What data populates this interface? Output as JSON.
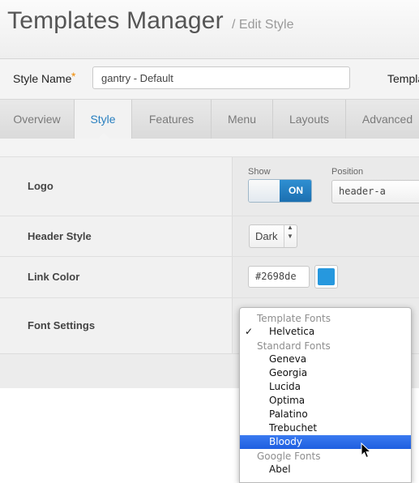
{
  "header": {
    "title": "Templates Manager",
    "subtitle": "/ Edit Style"
  },
  "namebar": {
    "label": "Style Name",
    "required_mark": "*",
    "value": "gantry - Default",
    "template_label": "Template"
  },
  "tabs": [
    {
      "label": "Overview"
    },
    {
      "label": "Style",
      "active": true
    },
    {
      "label": "Features"
    },
    {
      "label": "Menu"
    },
    {
      "label": "Layouts"
    },
    {
      "label": "Advanced"
    }
  ],
  "logo": {
    "label": "Logo",
    "show_label": "Show",
    "toggle_on_label": "ON",
    "position_label": "Position",
    "position_value": "header-a"
  },
  "header_style": {
    "label": "Header Style",
    "value": "Dark"
  },
  "link_color": {
    "label": "Link Color",
    "value": "#2698de",
    "swatch_color": "#2698de"
  },
  "font_settings": {
    "label": "Font Settings",
    "dropdown": {
      "groups": {
        "template": "Template Fonts",
        "standard": "Standard Fonts",
        "google": "Google Fonts"
      },
      "checked_item": "Helvetica",
      "check_mark": "✓",
      "standard_items": [
        "Geneva",
        "Georgia",
        "Lucida",
        "Optima",
        "Palatino",
        "Trebuchet",
        "Bloody"
      ],
      "highlighted_item": "Bloody",
      "google_items": [
        "Abel"
      ]
    }
  },
  "colors": {
    "accent": "#2a80c0",
    "toggle_on": "#1f7cc0",
    "selection": "#2a6ae8"
  }
}
